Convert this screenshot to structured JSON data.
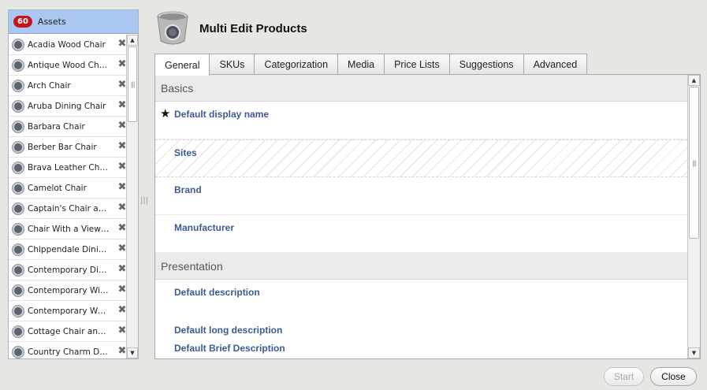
{
  "title": "Multi Edit Products",
  "assets": {
    "count": "60",
    "label": "Assets",
    "items": [
      "Acadia Wood Chair",
      "Antique Wood Chair",
      "Arch Chair",
      "Aruba Dining Chair",
      "Barbara Chair",
      "Berber Bar Chair",
      "Brava Leather Chair",
      "Camelot Chair",
      "Captain's Chair and...",
      "Chair With a View ...",
      "Chippendale Dining ...",
      "Contemporary Dinin...",
      "Contemporary Wind...",
      "Contemporary Woo...",
      "Cottage Chair and ...",
      "Country Charm Dini..."
    ]
  },
  "tabs": [
    "General",
    "SKUs",
    "Categorization",
    "Media",
    "Price Lists",
    "Suggestions",
    "Advanced"
  ],
  "active_tab": "General",
  "sections": {
    "basics": {
      "title": "Basics",
      "fields": [
        "Default display name",
        "Sites",
        "Brand",
        "Manufacturer"
      ]
    },
    "presentation": {
      "title": "Presentation",
      "fields": [
        "Default description",
        "Default long description",
        "Default Brief Description"
      ]
    }
  },
  "buttons": {
    "start": "Start",
    "close": "Close"
  }
}
